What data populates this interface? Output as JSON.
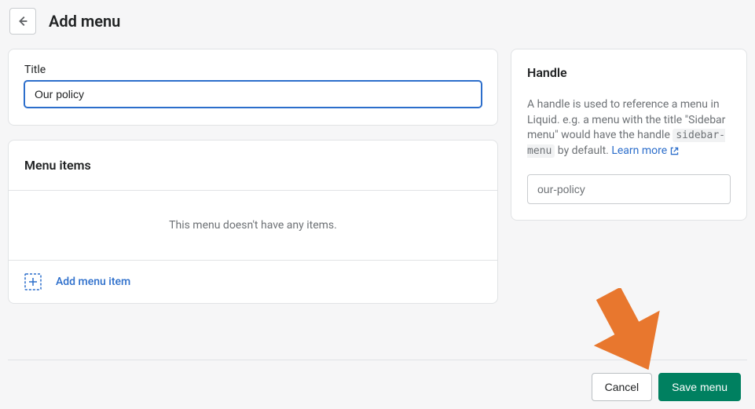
{
  "header": {
    "page_title": "Add menu"
  },
  "title_card": {
    "label": "Title",
    "value": "Our policy "
  },
  "menu_items": {
    "heading": "Menu items",
    "empty_message": "This menu doesn't have any items.",
    "add_label": "Add menu item"
  },
  "handle": {
    "heading": "Handle",
    "desc_part1": "A handle is used to reference a menu in Liquid. e.g. a menu with the title \"Sidebar menu\" would have the handle ",
    "desc_code": "sidebar-menu",
    "desc_part2": " by default. ",
    "learn_more": "Learn more",
    "input_value": "our-policy"
  },
  "footer": {
    "cancel": "Cancel",
    "save": "Save menu"
  }
}
